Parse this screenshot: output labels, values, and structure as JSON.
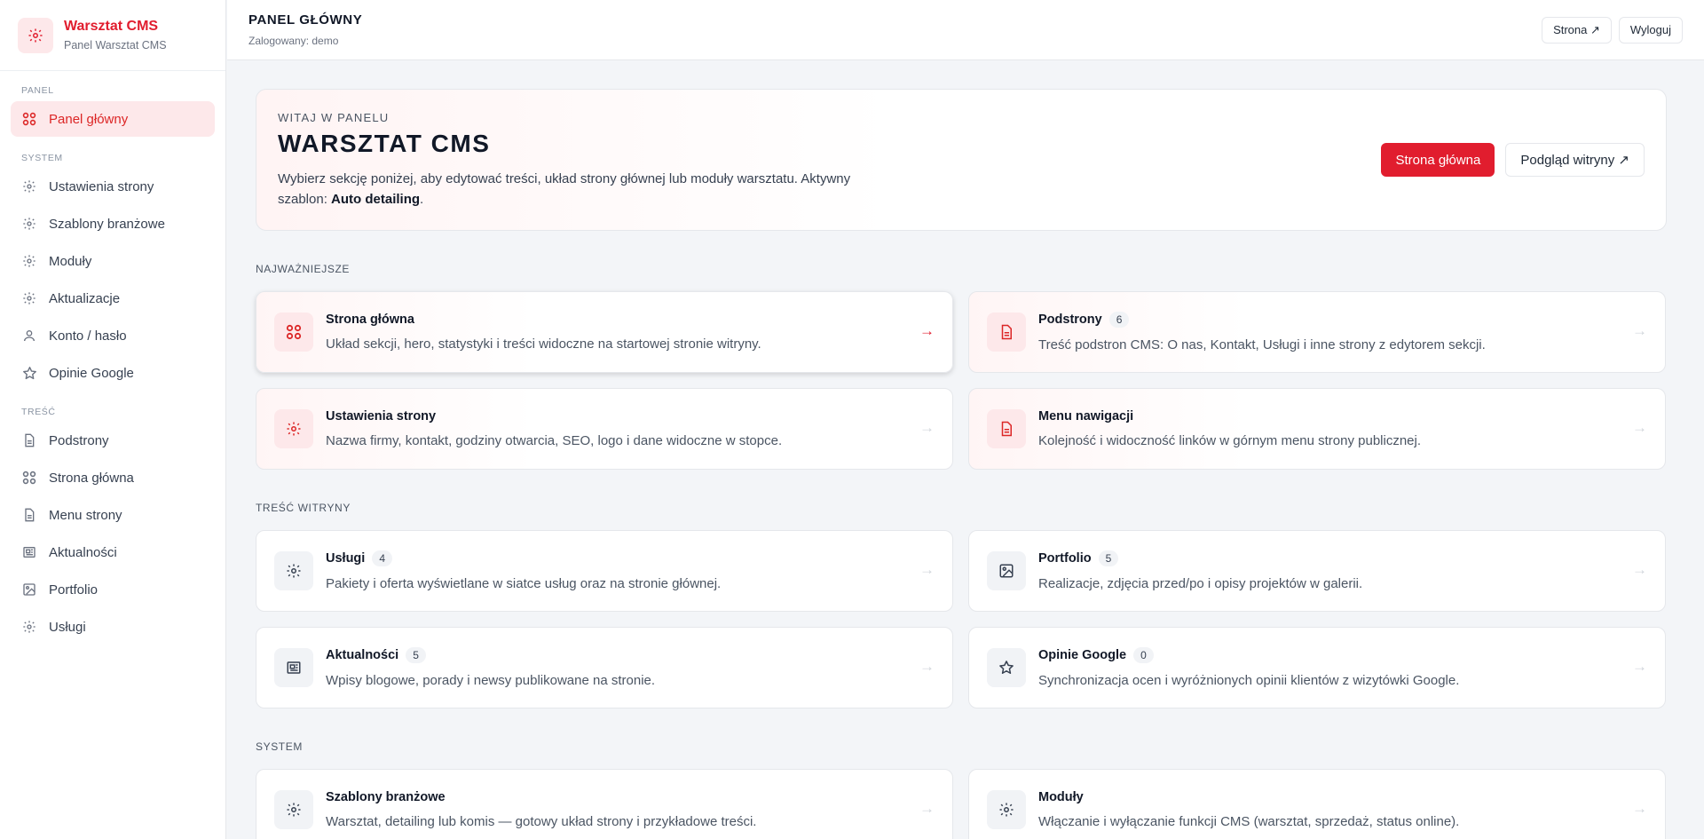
{
  "brand": {
    "title": "Warsztat CMS",
    "subtitle": "Panel Warsztat CMS",
    "icon": "gear-icon"
  },
  "sidebar": {
    "sections": [
      {
        "label": "PANEL",
        "items": [
          {
            "label": "Panel główny",
            "icon": "grid-icon",
            "active": true
          }
        ]
      },
      {
        "label": "SYSTEM",
        "items": [
          {
            "label": "Ustawienia strony",
            "icon": "gear-icon"
          },
          {
            "label": "Szablony branżowe",
            "icon": "gear-icon"
          },
          {
            "label": "Moduły",
            "icon": "gear-icon"
          },
          {
            "label": "Aktualizacje",
            "icon": "gear-icon"
          },
          {
            "label": "Konto / hasło",
            "icon": "user-icon"
          },
          {
            "label": "Opinie Google",
            "icon": "star-icon"
          }
        ]
      },
      {
        "label": "TREŚĆ",
        "items": [
          {
            "label": "Podstrony",
            "icon": "document-icon"
          },
          {
            "label": "Strona główna",
            "icon": "grid-icon"
          },
          {
            "label": "Menu strony",
            "icon": "document-icon"
          },
          {
            "label": "Aktualności",
            "icon": "newspaper-icon"
          },
          {
            "label": "Portfolio",
            "icon": "image-icon"
          },
          {
            "label": "Usługi",
            "icon": "gear-icon"
          }
        ]
      }
    ]
  },
  "topbar": {
    "title": "PANEL GŁÓWNY",
    "subtitle": "Zalogowany: demo",
    "site_button": "Strona ↗",
    "logout_button": "Wyloguj"
  },
  "hero": {
    "eyebrow": "WITAJ W PANELU",
    "title": "WARSZTAT CMS",
    "desc_before": "Wybierz sekcję poniżej, aby edytować treści, układ strony głównej lub moduły warsztatu. Aktywny szablon: ",
    "template_name": "Auto detailing",
    "desc_after": ".",
    "primary_button": "Strona główna",
    "secondary_button": "Podgląd witryny ↗"
  },
  "sections": {
    "important": "NAJWAŻNIEJSZE",
    "content": "TREŚĆ WITRYNY",
    "system": "SYSTEM"
  },
  "cards": {
    "home": {
      "title": "Strona główna",
      "desc": "Układ sekcji, hero, statystyki i treści widoczne na startowej stronie witryny."
    },
    "subpages": {
      "title": "Podstrony",
      "badge": "6",
      "desc": "Treść podstron CMS: O nas, Kontakt, Usługi i inne strony z edytorem sekcji."
    },
    "settings": {
      "title": "Ustawienia strony",
      "desc": "Nazwa firmy, kontakt, godziny otwarcia, SEO, logo i dane widoczne w stopce."
    },
    "navmenu": {
      "title": "Menu nawigacji",
      "desc": "Kolejność i widoczność linków w górnym menu strony publicznej."
    },
    "services": {
      "title": "Usługi",
      "badge": "4",
      "desc": "Pakiety i oferta wyświetlane w siatce usług oraz na stronie głównej."
    },
    "portfolio": {
      "title": "Portfolio",
      "badge": "5",
      "desc": "Realizacje, zdjęcia przed/po i opisy projektów w galerii."
    },
    "news": {
      "title": "Aktualności",
      "badge": "5",
      "desc": "Wpisy blogowe, porady i newsy publikowane na stronie."
    },
    "reviews": {
      "title": "Opinie Google",
      "badge": "0",
      "desc": "Synchronizacja ocen i wyróżnionych opinii klientów z wizytówki Google."
    },
    "templates": {
      "title": "Szablony branżowe",
      "desc": "Warsztat, detailing lub komis — gotowy układ strony i przykładowe treści."
    },
    "modules": {
      "title": "Moduły",
      "desc": "Włączanie i wyłączanie funkcji CMS (warsztat, sprzedaż, status online)."
    }
  },
  "arrow": "→",
  "colors": {
    "accent": "#e11d2e",
    "accent_bg": "#fde8ea"
  }
}
